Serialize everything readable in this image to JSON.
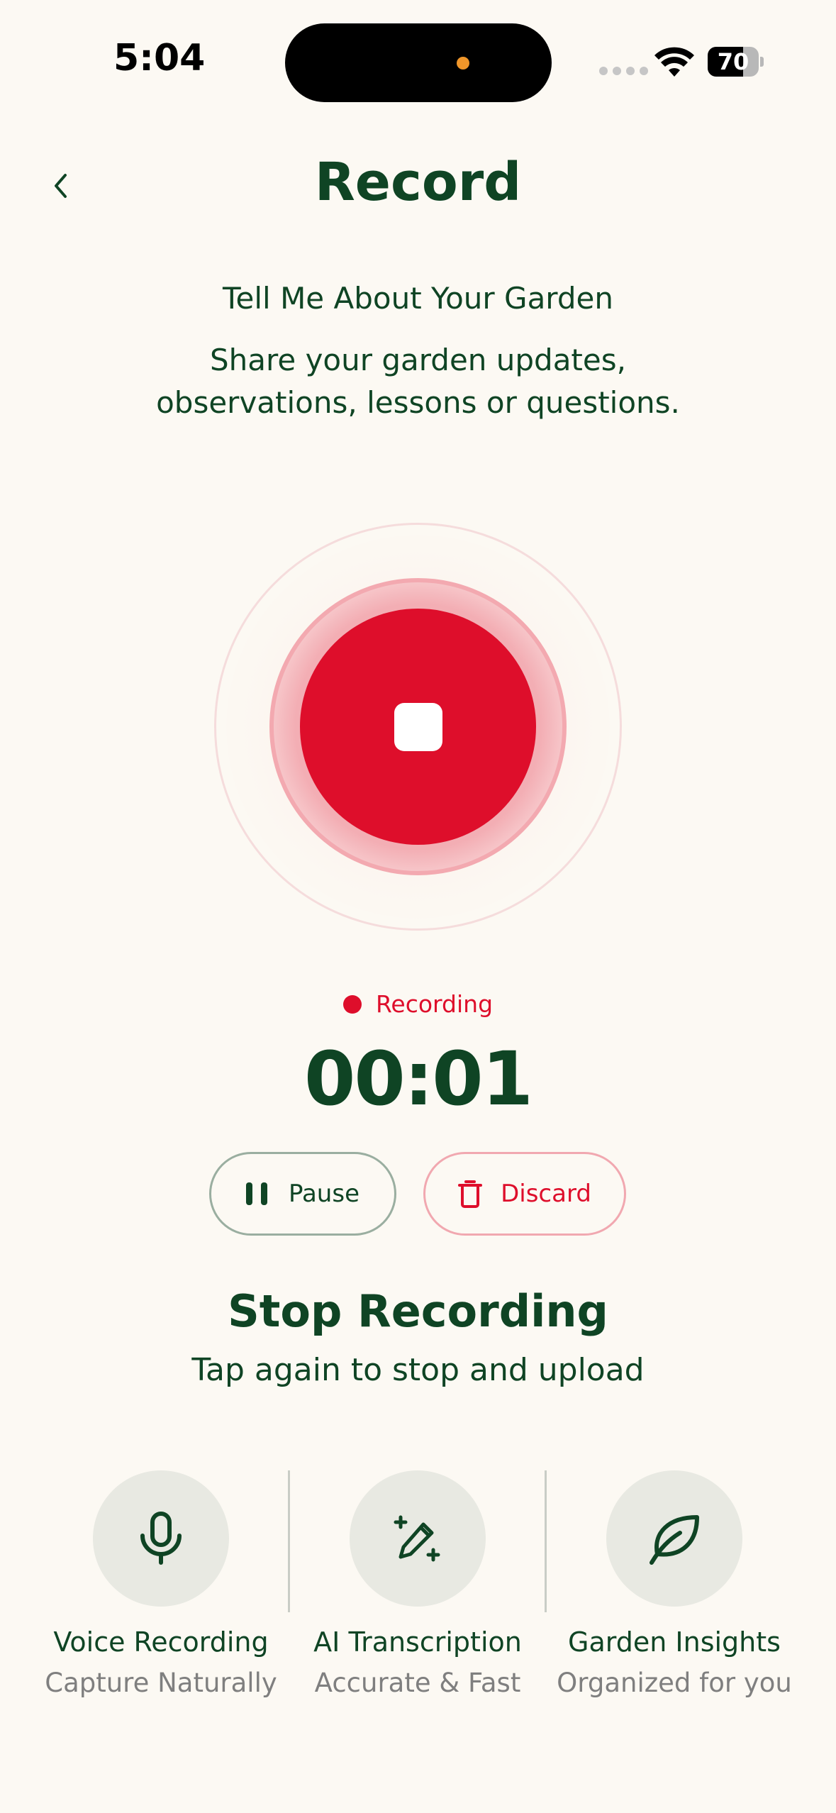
{
  "status_bar": {
    "time": "5:04",
    "battery": "70",
    "battery_level": 0.7
  },
  "header": {
    "title": "Record",
    "back_icon": "chevron-left-icon"
  },
  "intro": {
    "subtitle": "Tell Me About Your Garden",
    "description": "Share your garden updates, observations, lessons or questions."
  },
  "recorder": {
    "status_label": "Recording",
    "timer": "00:01",
    "record_button_icon": "stop-icon",
    "pause_label": "Pause",
    "discard_label": "Discard",
    "stop_heading": "Stop Recording",
    "stop_hint": "Tap again to stop and upload"
  },
  "features": [
    {
      "icon": "microphone-icon",
      "title": "Voice Recording",
      "subtitle": "Capture Naturally"
    },
    {
      "icon": "magic-pen-icon",
      "title": "AI Transcription",
      "subtitle": "Accurate & Fast"
    },
    {
      "icon": "leaf-icon",
      "title": "Garden Insights",
      "subtitle": "Organized for you"
    }
  ],
  "colors": {
    "background": "#fcf9f3",
    "primary_green": "#0f4424",
    "record_red": "#de0e2b",
    "muted_text": "#7f7f7f",
    "feature_circle": "#e8e9e2"
  }
}
